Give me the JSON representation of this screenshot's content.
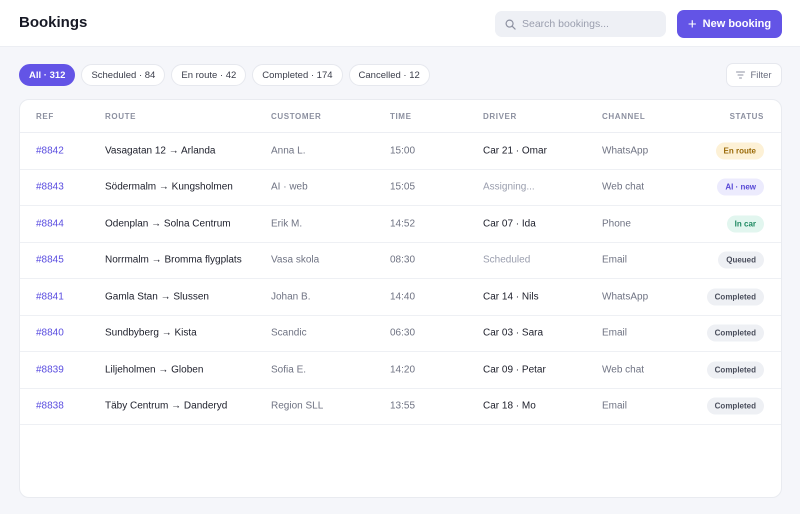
{
  "header": {
    "title": "Bookings",
    "search_placeholder": "Search bookings...",
    "new_booking_label": "New booking"
  },
  "filters": [
    {
      "label": "All · 312",
      "active": true
    },
    {
      "label": "Scheduled · 84",
      "active": false
    },
    {
      "label": "En route · 42",
      "active": false
    },
    {
      "label": "Completed · 174",
      "active": false
    },
    {
      "label": "Cancelled · 12",
      "active": false
    }
  ],
  "filter_button_label": "Filter",
  "table": {
    "columns": [
      "REF",
      "ROUTE",
      "CUSTOMER",
      "TIME",
      "DRIVER",
      "CHANNEL",
      "STATUS"
    ],
    "rows": [
      {
        "ref": "#8842",
        "route": "Vasagatan 12 → Arlanda",
        "customer": "Anna L.",
        "time": "15:00",
        "driver": "Car 21 · Omar",
        "channel": "WhatsApp",
        "status": "En route"
      },
      {
        "ref": "#8843",
        "route": "Södermalm → Kungsholmen",
        "customer": "AI · web",
        "time": "15:05",
        "driver": "Assigning...",
        "channel": "Web chat",
        "status": "AI · new"
      },
      {
        "ref": "#8844",
        "route": "Odenplan → Solna Centrum",
        "customer": "Erik M.",
        "time": "14:52",
        "driver": "Car 07 · Ida",
        "channel": "Phone",
        "status": "In car"
      },
      {
        "ref": "#8845",
        "route": "Norrmalm → Bromma flygplats",
        "customer": "Vasa skola",
        "time": "08:30",
        "driver": "Scheduled",
        "channel": "Email",
        "status": "Queued"
      },
      {
        "ref": "#8841",
        "route": "Gamla Stan → Slussen",
        "customer": "Johan B.",
        "time": "14:40",
        "driver": "Car 14 · Nils",
        "channel": "WhatsApp",
        "status": "Completed"
      },
      {
        "ref": "#8840",
        "route": "Sundbyberg → Kista",
        "customer": "Scandic",
        "time": "06:30",
        "driver": "Car 03 · Sara",
        "channel": "Email",
        "status": "Completed"
      },
      {
        "ref": "#8839",
        "route": "Liljeholmen → Globen",
        "customer": "Sofia E.",
        "time": "14:20",
        "driver": "Car 09 · Petar",
        "channel": "Web chat",
        "status": "Completed"
      },
      {
        "ref": "#8838",
        "route": "Täby Centrum → Danderyd",
        "customer": "Region SLL",
        "time": "13:55",
        "driver": "Car 18 · Mo",
        "channel": "Email",
        "status": "Completed"
      }
    ]
  },
  "colors": {
    "accent": "#6354e6",
    "en_route": "#9a6a08",
    "ai_new": "#5748d6",
    "in_car": "#1f8a62",
    "neutral": "#4a4e5c"
  }
}
